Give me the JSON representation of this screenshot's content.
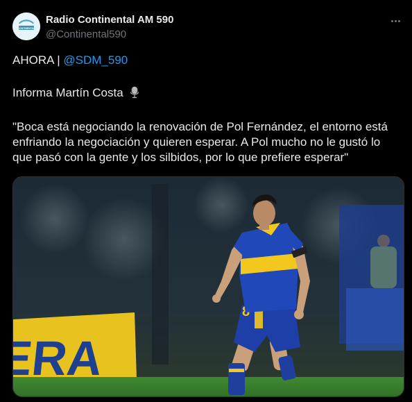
{
  "tweet": {
    "author_name": "Radio Continental AM 590",
    "author_handle": "@Continental590",
    "avatar_text": "CONTINENTAL",
    "line1_prefix": "AHORA | ",
    "mention": "@SDM_590",
    "line2": "Informa Martín Costa",
    "quote": "\"Boca está negociando la renovación de Pol Fernández, el entorno está enfriando la negociación y quieren esperar. A Pol mucho no le gustó lo que pasó con la gente y los silbidos, por lo que prefiere esperar\"",
    "image": {
      "banner_text": "ERA",
      "jersey_number": "8"
    }
  },
  "icons": {
    "more": "more-horizontal-icon",
    "mic": "microphone-icon"
  },
  "colors": {
    "background": "#000000",
    "text": "#e7e9ea",
    "secondary": "#71767b",
    "link": "#1d9bf0"
  }
}
